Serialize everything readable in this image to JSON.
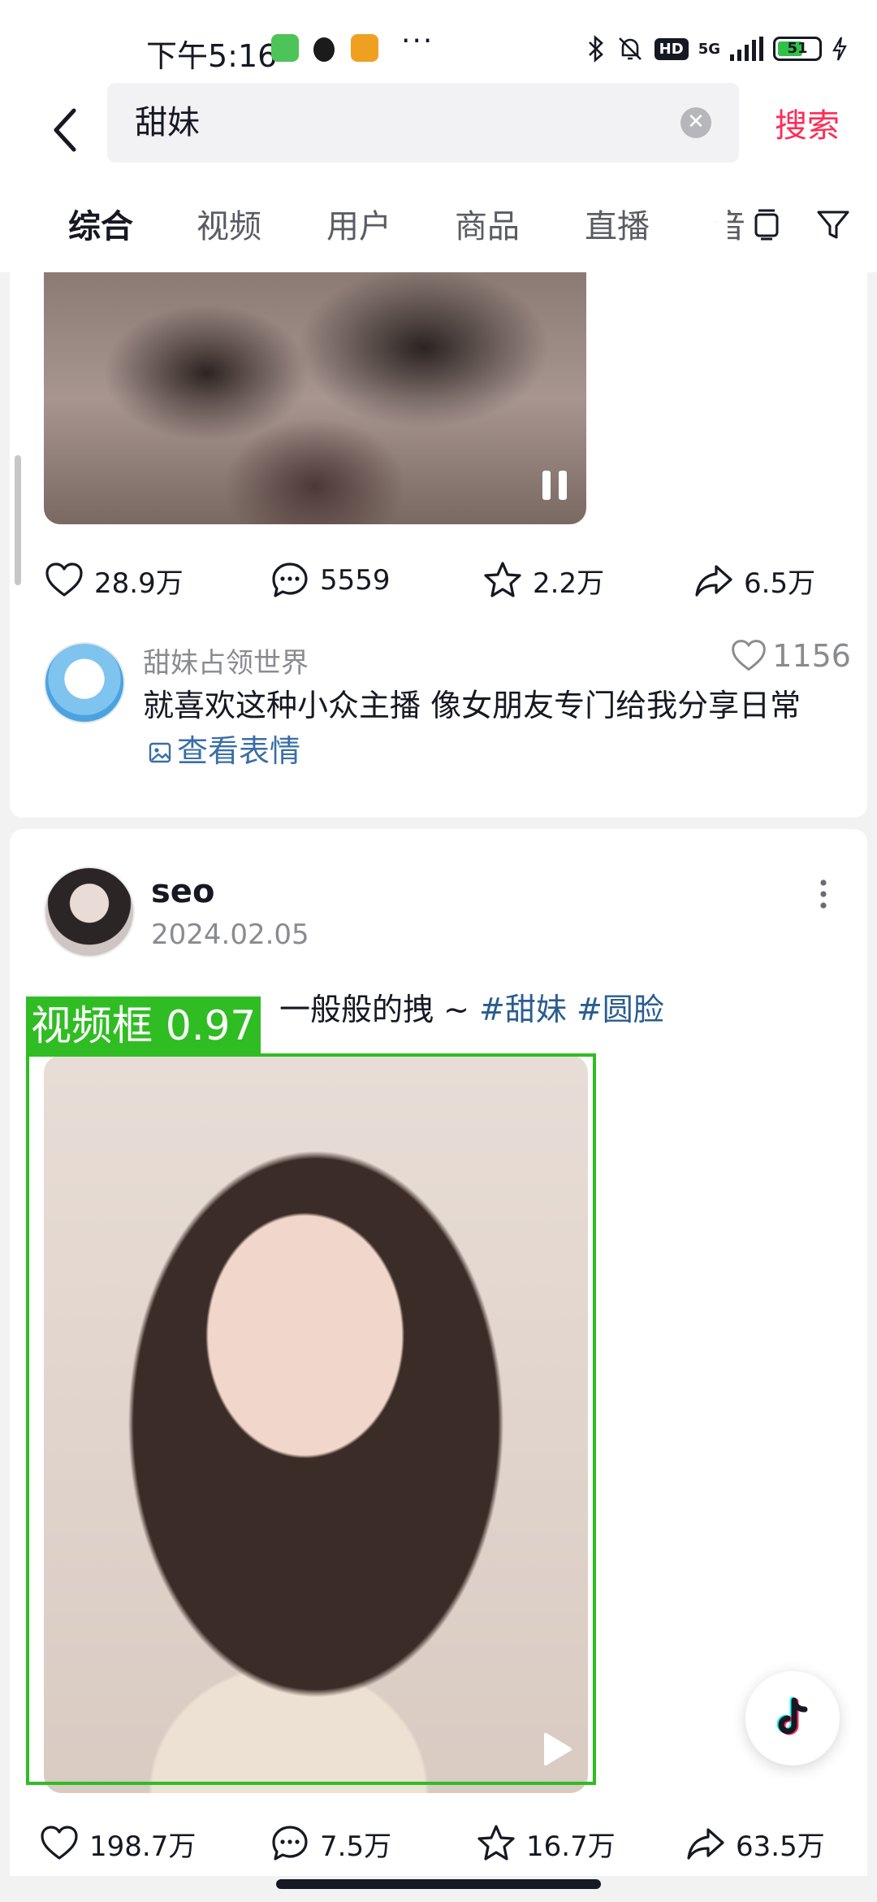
{
  "status_bar": {
    "time": "下午5:16",
    "more": "···",
    "network": "5G",
    "hd": "HD",
    "battery": "51",
    "icons": [
      "cat-app-icon",
      "qq-penguin-icon",
      "58-app-icon",
      "bluetooth-icon",
      "bell-muted-icon",
      "signal-icon",
      "battery-icon",
      "charging-icon"
    ]
  },
  "search": {
    "query": "甜妹",
    "submit_label": "搜索"
  },
  "tabs": [
    {
      "label": "综合",
      "active": true
    },
    {
      "label": "视频",
      "active": false
    },
    {
      "label": "用户",
      "active": false
    },
    {
      "label": "商品",
      "active": false
    },
    {
      "label": "直播",
      "active": false
    },
    {
      "label": "音",
      "active": false
    }
  ],
  "post1": {
    "stats": {
      "likes": "28.9万",
      "comments": "5559",
      "favorites": "2.2万",
      "shares": "6.5万"
    },
    "top_comment": {
      "username": "甜妹占领世界",
      "likes": "1156",
      "text": "就喜欢这种小众主播 像女朋友专门给我分享日常",
      "sticker_link": "查看表情"
    }
  },
  "post2": {
    "author": "seo",
    "date": "2024.02.05",
    "caption_visible": "一般般的拽 ~ ",
    "hashtags": [
      "#甜妹",
      "#圆脸"
    ],
    "stats": {
      "likes": "198.7万",
      "comments": "7.5万",
      "favorites": "16.7万",
      "shares": "63.5万"
    }
  },
  "detection": {
    "label": "视频框 0.97",
    "color": "#2fbd23"
  },
  "colors": {
    "accent": "#fe2c55",
    "hashtag": "#2a5d8f",
    "text_primary": "#161823",
    "text_secondary": "#8a8b91"
  }
}
